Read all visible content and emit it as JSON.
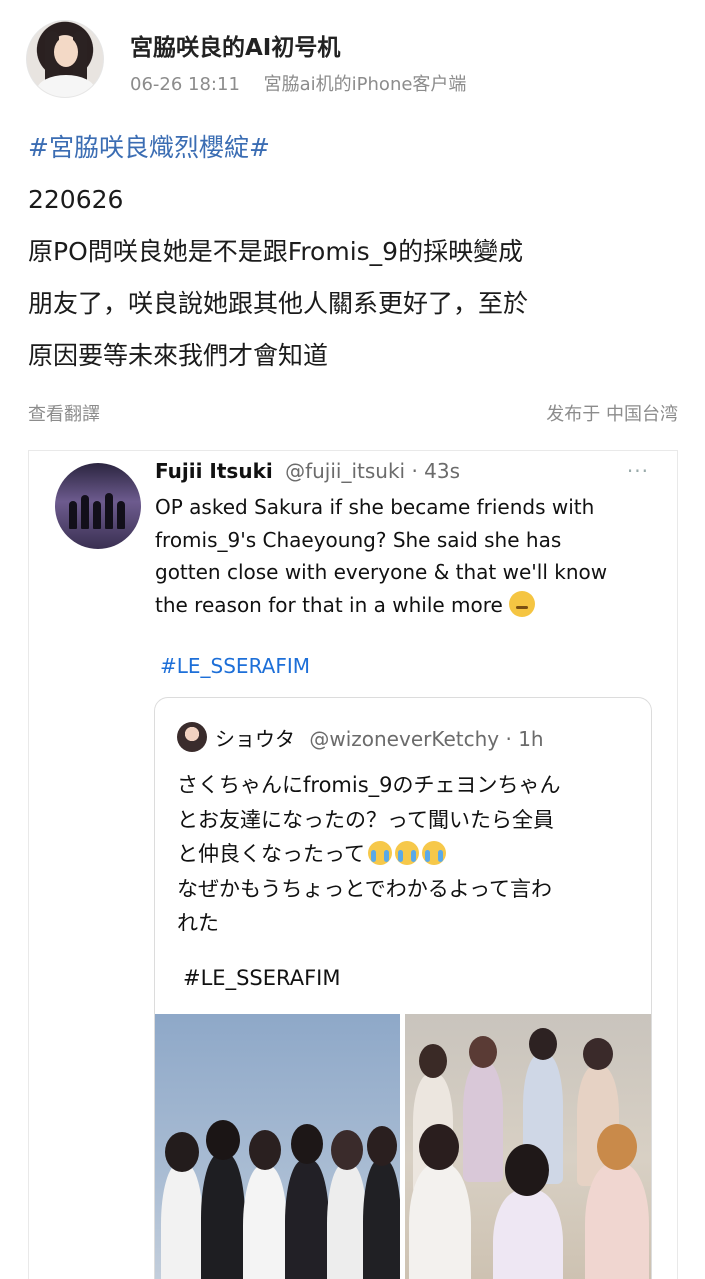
{
  "header": {
    "username": "宮脇咲良的AI初号机",
    "time": "06-26 18:11",
    "source": "宮脇ai机的iPhone客户端"
  },
  "post": {
    "hashtag": "#宮脇咲良熾烈櫻綻#",
    "lines": [
      "220626",
      "原PO問咲良她是不是跟Fromis_9的採映變成",
      "朋友了，咲良說她跟其他人關系更好了，至於",
      "原因要等未來我們才會知道"
    ]
  },
  "actions": {
    "translate": "查看翻譯",
    "location": "发布于 中国台湾"
  },
  "tweet": {
    "name": "Fujii Itsuki",
    "handle": "@fujii_itsuki · 43s",
    "more": "···",
    "lines": [
      "OP asked Sakura if she became friends with",
      "fromis_9's Chaeyoung? She said she has",
      "gotten close with everyone & that we'll know",
      "the reason for that in a while more"
    ],
    "emoji": "thinking-face",
    "hashtag": "#LE_SSERAFIM"
  },
  "quote": {
    "name": "ショウタ",
    "handle": "@wizoneverKetchy · 1h",
    "lines": [
      "さくちゃんにfromis_9のチェヨンちゃん",
      "とお友達になったの？って聞いたら全員",
      "と仲良くなったって",
      "なぜかもうちょっとでわかるよって言わ",
      "れた"
    ],
    "emoji": "loudly-crying-face",
    "hashtag": "#LE_SSERAFIM"
  },
  "colors": {
    "hashtag_blue": "#3b6db3",
    "twitter_link": "#1d6fd8",
    "meta_gray": "#8c8c8c"
  }
}
